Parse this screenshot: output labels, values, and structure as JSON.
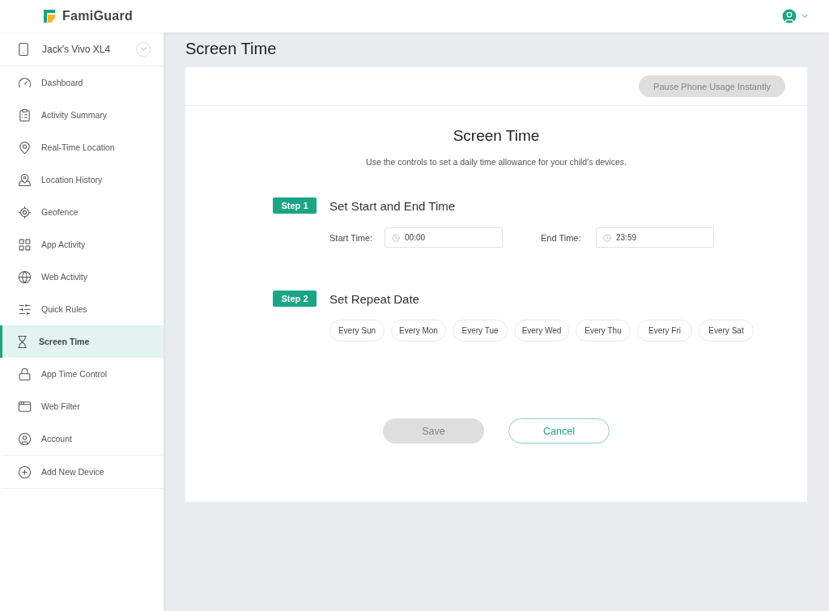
{
  "header": {
    "brand": "FamiGuard"
  },
  "sidebar": {
    "device": "Jack's Vivo XL4",
    "items": [
      {
        "kind": "dashboard",
        "label": "Dashboard",
        "selected": false
      },
      {
        "kind": "summary",
        "label": "Activity Summary",
        "selected": false
      },
      {
        "kind": "location",
        "label": "Real-Time Location",
        "selected": false
      },
      {
        "kind": "history",
        "label": "Location History",
        "selected": false
      },
      {
        "kind": "geofence",
        "label": "Geofence",
        "selected": false
      },
      {
        "kind": "apps",
        "label": "App Activity",
        "selected": false
      },
      {
        "kind": "web",
        "label": "Web Activity",
        "selected": false
      },
      {
        "kind": "rules",
        "label": "Quick Rules",
        "selected": false
      },
      {
        "kind": "screentime",
        "label": "Screen Time",
        "selected": true
      },
      {
        "kind": "apptime",
        "label": "App Time Control",
        "selected": false
      },
      {
        "kind": "filter",
        "label": "Web Filter",
        "selected": false
      },
      {
        "kind": "account",
        "label": "Account",
        "selected": false
      }
    ],
    "add_device": "Add New Device"
  },
  "page_title": "Screen Time",
  "pause_button": {
    "label": "Pause Phone Usage Instantly",
    "disabled": true
  },
  "card": {
    "title": "Screen Time",
    "subtitle": "Use the controls to set a daily time allowance for your child's devices.",
    "step1": {
      "badge": "Step 1",
      "title": "Set Start and End Time",
      "start_label": "Start Time:",
      "start_value": "00:00",
      "end_label": "End Time:",
      "end_value": "23:59"
    },
    "step2": {
      "badge": "Step 2",
      "title": "Set Repeat Date",
      "days": [
        {
          "label": "Every Sun",
          "selected": false
        },
        {
          "label": "Every Mon",
          "selected": false
        },
        {
          "label": "Every Tue",
          "selected": false
        },
        {
          "label": "Every Wed",
          "selected": false
        },
        {
          "label": "Every Thu",
          "selected": false
        },
        {
          "label": "Every Fri",
          "selected": false
        },
        {
          "label": "Every Sat",
          "selected": false
        }
      ]
    },
    "save": {
      "label": "Save",
      "disabled": true
    },
    "cancel": {
      "label": "Cancel"
    }
  }
}
